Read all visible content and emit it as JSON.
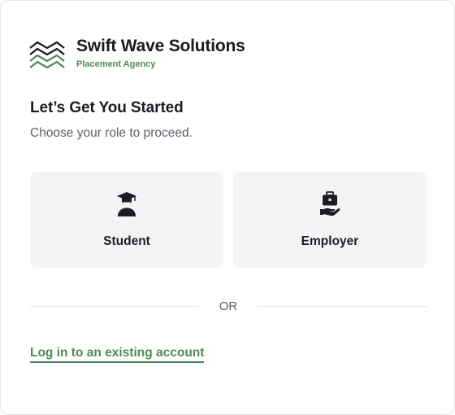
{
  "brand": {
    "name": "Swift Wave Solutions",
    "tagline": "Placement Agency",
    "accent_color": "#4f8a55",
    "logo_icon": "wave-lines-icon"
  },
  "intro": {
    "title": "Let’s Get You Started",
    "subtitle": "Choose your role to proceed."
  },
  "roles": [
    {
      "label": "Student",
      "icon": "graduate-icon"
    },
    {
      "label": "Employer",
      "icon": "briefcase-hand-icon"
    }
  ],
  "divider": {
    "label": "OR"
  },
  "login": {
    "label": "Log in to an existing account"
  }
}
